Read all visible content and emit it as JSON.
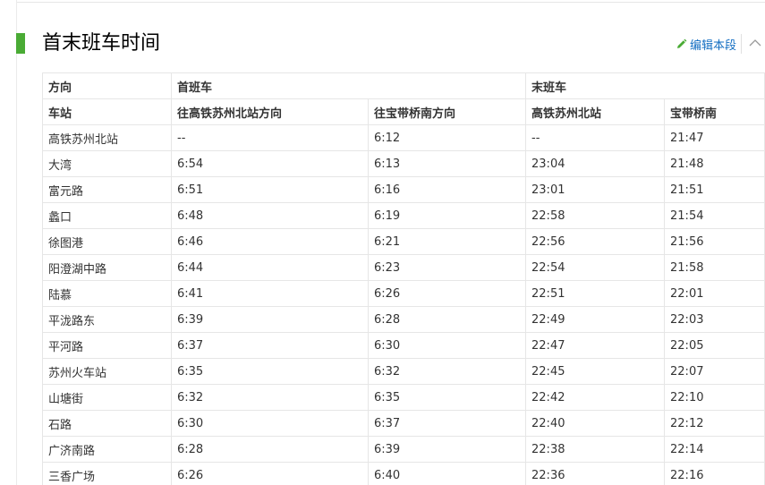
{
  "section": {
    "title": "首末班车时间",
    "edit_label": "编辑本段"
  },
  "table": {
    "group_headers": {
      "direction": "方向",
      "first_train": "首班车",
      "last_train": "末班车"
    },
    "sub_headers": {
      "station": "车站",
      "first_to_north": "往高铁苏州北站方向",
      "first_to_south": "往宝带桥南方向",
      "last_north": "高铁苏州北站",
      "last_south": "宝带桥南"
    },
    "rows": [
      {
        "station": "高铁苏州北站",
        "first_north": "--",
        "first_south": "6:12",
        "last_north": "--",
        "last_south": "21:47"
      },
      {
        "station": "大湾",
        "first_north": "6:54",
        "first_south": "6:13",
        "last_north": "23:04",
        "last_south": "21:48"
      },
      {
        "station": "富元路",
        "first_north": "6:51",
        "first_south": "6:16",
        "last_north": "23:01",
        "last_south": "21:51"
      },
      {
        "station": "蠡口",
        "first_north": "6:48",
        "first_south": "6:19",
        "last_north": "22:58",
        "last_south": "21:54"
      },
      {
        "station": "徐图港",
        "first_north": "6:46",
        "first_south": "6:21",
        "last_north": "22:56",
        "last_south": "21:56"
      },
      {
        "station": "阳澄湖中路",
        "first_north": "6:44",
        "first_south": "6:23",
        "last_north": "22:54",
        "last_south": "21:58"
      },
      {
        "station": "陆慕",
        "first_north": "6:41",
        "first_south": "6:26",
        "last_north": "22:51",
        "last_south": "22:01"
      },
      {
        "station": "平泷路东",
        "first_north": "6:39",
        "first_south": "6:28",
        "last_north": "22:49",
        "last_south": "22:03"
      },
      {
        "station": "平河路",
        "first_north": "6:37",
        "first_south": "6:30",
        "last_north": "22:47",
        "last_south": "22:05"
      },
      {
        "station": "苏州火车站",
        "first_north": "6:35",
        "first_south": "6:32",
        "last_north": "22:45",
        "last_south": "22:07"
      },
      {
        "station": "山塘街",
        "first_north": "6:32",
        "first_south": "6:35",
        "last_north": "22:42",
        "last_south": "22:10"
      },
      {
        "station": "石路",
        "first_north": "6:30",
        "first_south": "6:37",
        "last_north": "22:40",
        "last_south": "22:12"
      },
      {
        "station": "广济南路",
        "first_north": "6:28",
        "first_south": "6:39",
        "last_north": "22:38",
        "last_south": "22:14"
      },
      {
        "station": "三香广场",
        "first_north": "6:26",
        "first_south": "6:40",
        "last_north": "22:36",
        "last_south": "22:16"
      }
    ]
  },
  "colors": {
    "accent": "#4aab35",
    "link": "#136ec2",
    "border": "#e6e6e6"
  },
  "icons": {
    "edit": "pencil-icon",
    "collapse": "chevron-up-icon"
  }
}
